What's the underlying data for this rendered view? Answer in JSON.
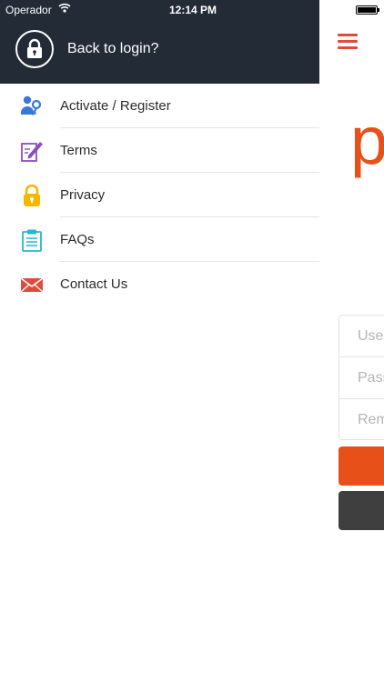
{
  "status_bar": {
    "carrier": "Operador",
    "time": "12:14 PM"
  },
  "header": {
    "back_label": "Back to login?"
  },
  "menu": {
    "items": [
      {
        "label": "Activate / Register",
        "icon": "key-user-icon"
      },
      {
        "label": "Terms",
        "icon": "document-pen-icon"
      },
      {
        "label": "Privacy",
        "icon": "padlock-icon"
      },
      {
        "label": "FAQs",
        "icon": "clipboard-icon"
      },
      {
        "label": "Contact Us",
        "icon": "envelope-icon"
      }
    ]
  },
  "main": {
    "logo_letter": "p",
    "username_placeholder": "User",
    "password_placeholder": "Pass",
    "remember_label": "Rem"
  },
  "colors": {
    "header_bg": "#232b36",
    "accent_orange": "#e8501a",
    "hamburger_red": "#e24b3a",
    "dark_button": "#3f3f3f",
    "icon_blue": "#3a78d8",
    "icon_purple": "#8a4fbf",
    "icon_yellow": "#f5b800",
    "icon_cyan": "#27b6cf",
    "icon_red": "#e24b3a"
  }
}
